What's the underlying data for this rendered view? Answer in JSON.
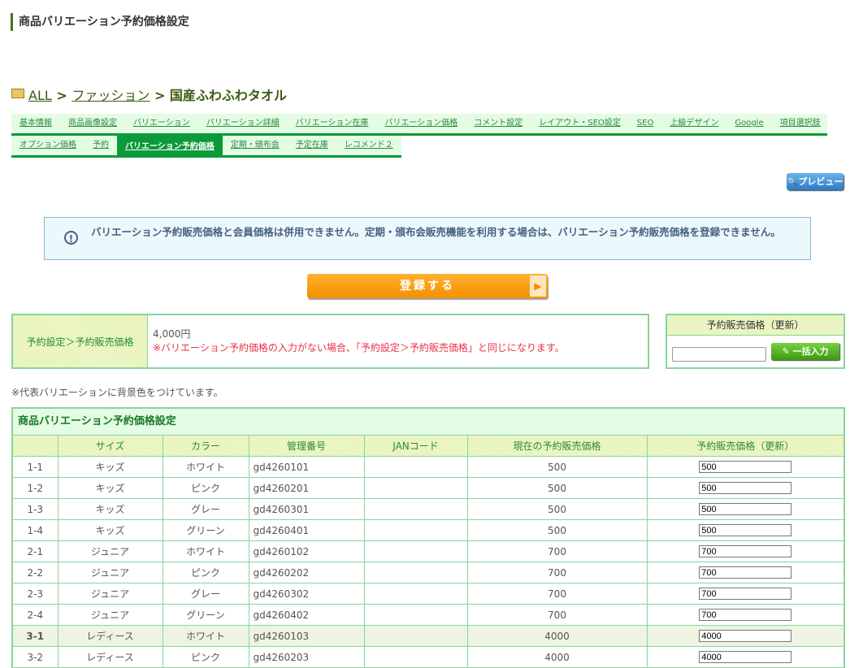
{
  "page_title": "商品バリエーション予約価格設定",
  "breadcrumb": {
    "items": [
      "ALL",
      "ファッション"
    ],
    "current": "国産ふわふわタオル",
    "sep": ">"
  },
  "tabs_row1": [
    "基本情報",
    "商品画像設定",
    "バリエーション",
    "バリエーション詳細",
    "バリエーション在庫",
    "バリエーション価格",
    "コメント設定",
    "レイアウト・SEO設定",
    "SEO",
    "上級デザイン",
    "Google",
    "項目選択肢"
  ],
  "tabs_row2": [
    "オプション価格",
    "予約",
    "バリエーション予約価格",
    "定期・頒布会",
    "予定在庫",
    "レコメンド２"
  ],
  "active_tab": "バリエーション予約価格",
  "preview_label": "プレビュー",
  "notice": "バリエーション予約販売価格と会員価格は併用できません。定期・頒布会販売機能を利用する場合は、バリエーション予約販売価格を登録できません。",
  "submit_label": "登録する",
  "setting": {
    "label": "予約設定＞予約販売価格",
    "price": "4,000円",
    "note": "※バリエーション予約価格の入力がない場合、「予約設定＞予約販売価格」と同じになります。"
  },
  "bulk": {
    "header": "予約販売価格（更新）",
    "input_value": "",
    "button": "一括入力"
  },
  "rep_note": "※代表バリエーションに背景色をつけています。",
  "table": {
    "caption": "商品バリエーション予約価格設定",
    "headers": [
      "",
      "サイズ",
      "カラー",
      "管理番号",
      "JANコード",
      "現在の予約販売価格",
      "予約販売価格（更新）"
    ],
    "rows": [
      {
        "id": "1-1",
        "size": "キッズ",
        "color": "ホワイト",
        "code": "gd4260101",
        "jan": "",
        "current": "500",
        "new": "500",
        "rep": false
      },
      {
        "id": "1-2",
        "size": "キッズ",
        "color": "ピンク",
        "code": "gd4260201",
        "jan": "",
        "current": "500",
        "new": "500",
        "rep": false
      },
      {
        "id": "1-3",
        "size": "キッズ",
        "color": "グレー",
        "code": "gd4260301",
        "jan": "",
        "current": "500",
        "new": "500",
        "rep": false
      },
      {
        "id": "1-4",
        "size": "キッズ",
        "color": "グリーン",
        "code": "gd4260401",
        "jan": "",
        "current": "500",
        "new": "500",
        "rep": false
      },
      {
        "id": "2-1",
        "size": "ジュニア",
        "color": "ホワイト",
        "code": "gd4260102",
        "jan": "",
        "current": "700",
        "new": "700",
        "rep": false
      },
      {
        "id": "2-2",
        "size": "ジュニア",
        "color": "ピンク",
        "code": "gd4260202",
        "jan": "",
        "current": "700",
        "new": "700",
        "rep": false
      },
      {
        "id": "2-3",
        "size": "ジュニア",
        "color": "グレー",
        "code": "gd4260302",
        "jan": "",
        "current": "700",
        "new": "700",
        "rep": false
      },
      {
        "id": "2-4",
        "size": "ジュニア",
        "color": "グリーン",
        "code": "gd4260402",
        "jan": "",
        "current": "700",
        "new": "700",
        "rep": false
      },
      {
        "id": "3-1",
        "size": "レディース",
        "color": "ホワイト",
        "code": "gd4260103",
        "jan": "",
        "current": "4000",
        "new": "4000",
        "rep": true
      },
      {
        "id": "3-2",
        "size": "レディース",
        "color": "ピンク",
        "code": "gd4260203",
        "jan": "",
        "current": "4000",
        "new": "4000",
        "rep": false
      }
    ]
  }
}
